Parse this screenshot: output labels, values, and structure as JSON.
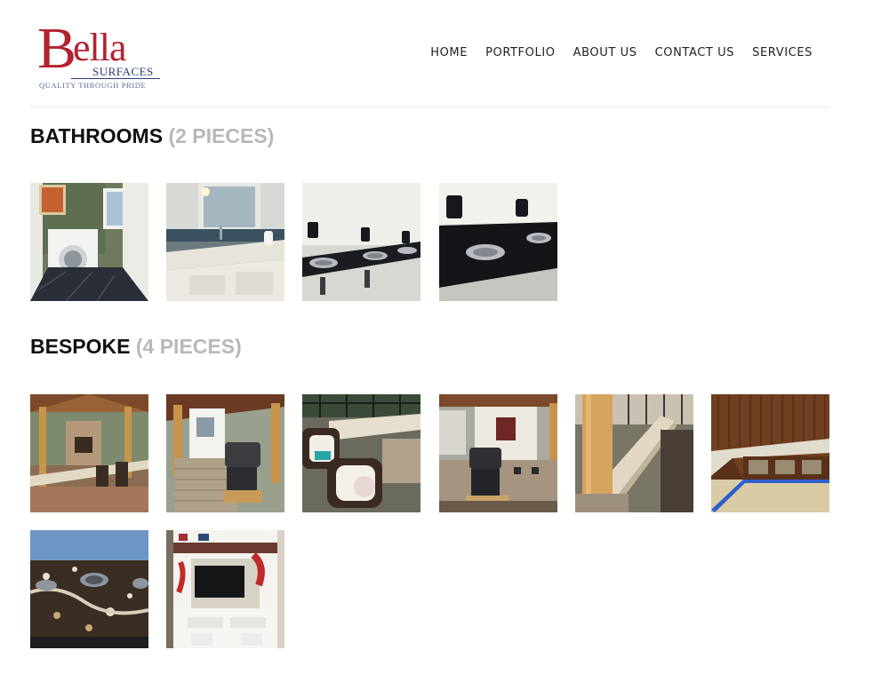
{
  "logo": {
    "initial": "B",
    "rest": "ella",
    "subtitle": "SURFACES",
    "tagline": "QUALITY THROUGH PRIDE"
  },
  "nav": {
    "items": [
      {
        "label": "HOME"
      },
      {
        "label": "PORTFOLIO"
      },
      {
        "label": "ABOUT US"
      },
      {
        "label": "CONTACT US"
      },
      {
        "label": "SERVICES"
      }
    ]
  },
  "sections": [
    {
      "name": "BATHROOMS",
      "count": "(2 PIECES)",
      "photos": [
        "laundry room",
        "bathroom vanity",
        "black granite sinks",
        "black granite sink counter"
      ]
    },
    {
      "name": "BESPOKE",
      "count": "(4 PIECES)",
      "photos": [
        "outdoor bar pergola",
        "outdoor kitchen grill",
        "patio seating counter",
        "pool house grill station",
        "granite bar top post",
        "wood bench granite",
        "granite with round cutouts",
        "white entertainment center"
      ]
    }
  ],
  "colors": {
    "brand_red": "#b2232f",
    "brand_navy": "#2a3a7a",
    "count_gray": "#b8b8b8"
  }
}
